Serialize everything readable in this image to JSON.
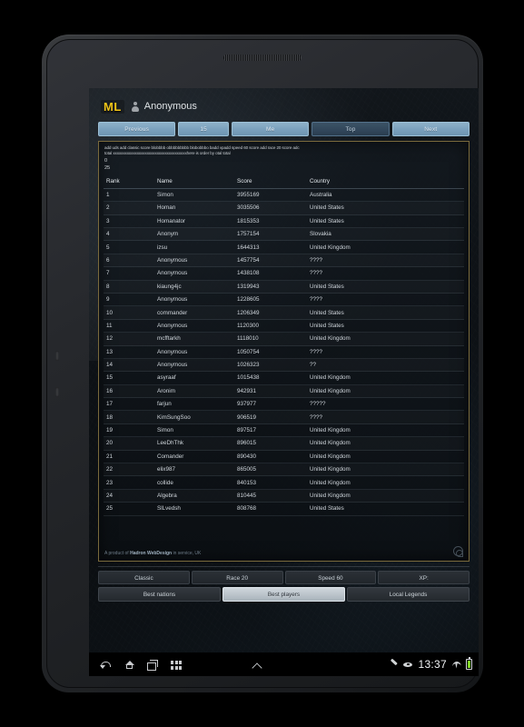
{
  "app": {
    "logo": "ML",
    "user_name": "Anonymous"
  },
  "nav_buttons": [
    {
      "label": "Previous",
      "active": false
    },
    {
      "label": "15",
      "active": false
    },
    {
      "label": "Me",
      "active": false
    },
    {
      "label": "Top",
      "active": true
    },
    {
      "label": "Next",
      "active": false
    }
  ],
  "console": {
    "line1": "add uds add classic score blobbbb obbbbbbbbb blobobbbo badd vpadd speed 60 score add race 20 score adc",
    "line2": "total xxxxxxxxxxxxxxxxxxxxxxxxxxxxxxxxxxxxxhere is order by otal total",
    "line3": "0",
    "line4": "25"
  },
  "table": {
    "headers": {
      "rank": "Rank",
      "name": "Name",
      "score": "Score",
      "country": "Country"
    },
    "rows": [
      {
        "rank": "1",
        "name": "Simon",
        "score": "3955169",
        "country": "Australia"
      },
      {
        "rank": "2",
        "name": "Homan",
        "score": "3035506",
        "country": "United States"
      },
      {
        "rank": "3",
        "name": "Homanator",
        "score": "1815353",
        "country": "United States"
      },
      {
        "rank": "4",
        "name": "Anonym",
        "score": "1757154",
        "country": "Slovakia"
      },
      {
        "rank": "5",
        "name": "izsu",
        "score": "1644313",
        "country": "United Kingdom"
      },
      {
        "rank": "6",
        "name": "Anonymous",
        "score": "1457754",
        "country": "????"
      },
      {
        "rank": "7",
        "name": "Anonymous",
        "score": "1438108",
        "country": "????"
      },
      {
        "rank": "8",
        "name": "kiaung4jc",
        "score": "1319943",
        "country": "United States"
      },
      {
        "rank": "9",
        "name": "Anonymous",
        "score": "1228605",
        "country": "????"
      },
      {
        "rank": "10",
        "name": "commander",
        "score": "1206349",
        "country": "United States"
      },
      {
        "rank": "11",
        "name": "Anonymous",
        "score": "1120300",
        "country": "United States"
      },
      {
        "rank": "12",
        "name": "mcfftarkh",
        "score": "1118010",
        "country": "United Kingdom"
      },
      {
        "rank": "13",
        "name": "Anonymous",
        "score": "1050754",
        "country": "????"
      },
      {
        "rank": "14",
        "name": "Anonymous",
        "score": "1026323",
        "country": "??"
      },
      {
        "rank": "15",
        "name": "asyraaf",
        "score": "1015438",
        "country": "United Kingdom"
      },
      {
        "rank": "16",
        "name": "Aronim",
        "score": "942931",
        "country": "United Kingdom"
      },
      {
        "rank": "17",
        "name": "farjun",
        "score": "937977",
        "country": "?????"
      },
      {
        "rank": "18",
        "name": "KimSungSoo",
        "score": "906519",
        "country": "????"
      },
      {
        "rank": "19",
        "name": "Simon",
        "score": "897517",
        "country": "United Kingdom"
      },
      {
        "rank": "20",
        "name": "LeeDhThk",
        "score": "896015",
        "country": "United Kingdom"
      },
      {
        "rank": "21",
        "name": "Comander",
        "score": "890430",
        "country": "United Kingdom"
      },
      {
        "rank": "22",
        "name": "elix987",
        "score": "865005",
        "country": "United Kingdom"
      },
      {
        "rank": "23",
        "name": "collide",
        "score": "840153",
        "country": "United Kingdom"
      },
      {
        "rank": "24",
        "name": "Algebra",
        "score": "810445",
        "country": "United Kingdom"
      },
      {
        "rank": "25",
        "name": "SlLvedsh",
        "score": "808768",
        "country": "United States"
      }
    ]
  },
  "credit": {
    "prefix": "A product of ",
    "brand": "Hadron WebDesign",
    "suffix": " in service, UK"
  },
  "filter_buttons": [
    {
      "label": "Classic"
    },
    {
      "label": "Race 20"
    },
    {
      "label": "Speed 60"
    },
    {
      "label": "XP:"
    }
  ],
  "mode_buttons": [
    {
      "label": "Best nations",
      "active": false
    },
    {
      "label": "Best players",
      "active": true
    },
    {
      "label": "Local Legends",
      "active": false
    }
  ],
  "system_bar": {
    "time": "13:37",
    "icons": {
      "back": "back-icon",
      "home": "home-icon",
      "recents": "recents-icon",
      "apps": "apps-grid-icon",
      "chevron": "chevron-up-icon",
      "pen": "pen-icon",
      "eye": "eye-icon",
      "wifi": "wifi-icon",
      "battery": "battery-icon"
    }
  },
  "colors": {
    "accent": "#f0c419",
    "nav_button": "#7ba1bd",
    "panel_border": "#7a6a3c",
    "battery": "#7ed321"
  }
}
